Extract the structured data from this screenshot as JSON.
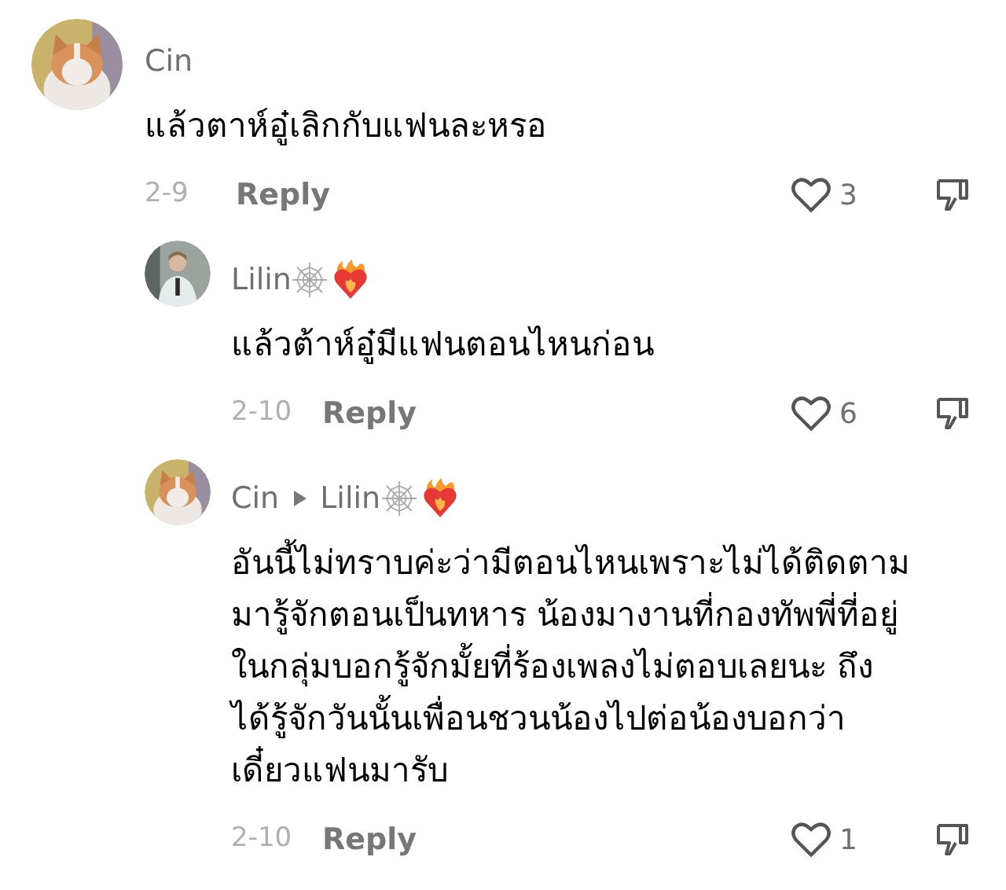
{
  "comments": [
    {
      "kind": "top",
      "author": "Cin",
      "text": "แล้วตาห์อู๋เลิกกับแฟนละหรอ",
      "date": "2-9",
      "reply": "Reply",
      "likes": "3"
    },
    {
      "kind": "reply",
      "author": "Lilin",
      "text": "แล้วต้าห์อู๋มีแฟนตอนไหนก่อน",
      "date": "2-10",
      "reply": "Reply",
      "likes": "6"
    },
    {
      "kind": "reply",
      "author": "Cin",
      "reply_to": "Lilin",
      "text": "อันนี้ไม่ทราบค่ะว่ามีตอนไหนเพราะไม่ได้ติดตาม\nมารู้จักตอนเป็นทหาร น้องมางานที่กองทัพพี่ที่อยู่\nในกลุ่มบอกรู้จักมั้ยที่ร้องเพลงไม่ตอบเลยนะ ถึง\nได้รู้จักวันนั้นเพื่อนชวนน้องไปต่อน้องบอกว่า\nเดี๋ยวแฟนมารับ",
      "date": "2-10",
      "reply": "Reply",
      "likes": "1"
    }
  ]
}
